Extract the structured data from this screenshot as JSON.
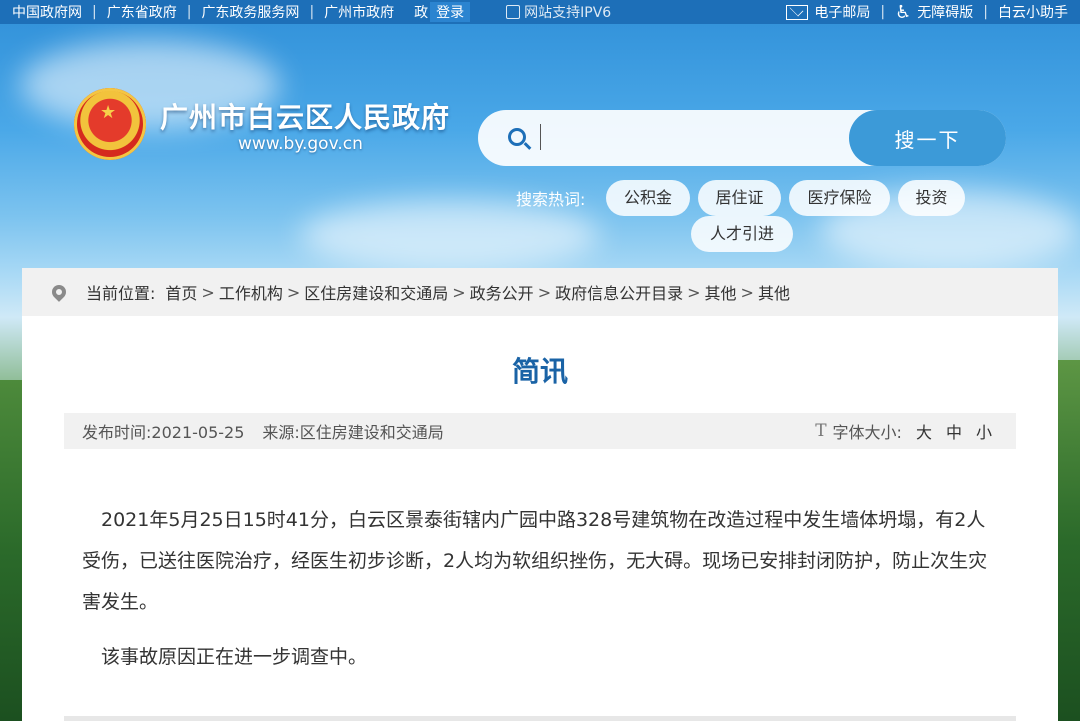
{
  "topbar": {
    "links": [
      "中国政府网",
      "广东省政府",
      "广东政务服务网",
      "广州市政府"
    ],
    "separator": "|",
    "zhengwu": "政",
    "login": "登录",
    "ipv6": "网站支持IPV6",
    "email": "电子邮局",
    "accessible": "无障碍版",
    "assistant": "白云小助手"
  },
  "header": {
    "site_title": "广州市白云区人民政府",
    "site_url": "www.by.gov.cn"
  },
  "search": {
    "placeholder": "",
    "button": "搜一下",
    "hot_label": "搜索热词:",
    "hot_tags": [
      "公积金",
      "居住证",
      "医疗保险",
      "投资",
      "人才引进"
    ]
  },
  "breadcrumb": {
    "label": "当前位置:",
    "items": [
      "首页",
      "工作机构",
      "区住房建设和交通局",
      "政务公开",
      "政府信息公开目录",
      "其他",
      "其他"
    ],
    "sep": ">"
  },
  "article": {
    "title": "简讯",
    "publish_label": "发布时间:",
    "publish_date": "2021-05-25",
    "source_label": "来源:",
    "source": "区住房建设和交通局",
    "fontsize_label": "字体大小:",
    "sizes": [
      "大",
      "中",
      "小"
    ],
    "paragraphs": [
      "2021年5月25日15时41分，白云区景泰街辖内广园中路328号建筑物在改造过程中发生墙体坍塌，有2人受伤，已送往医院治疗，经医生初步诊断，2人均为软组织挫伤，无大碍。现场已安排封闭防护，防止次生灾害发生。",
      "该事故原因正在进一步调查中。"
    ]
  },
  "colors": {
    "topbar": "#1d6fb8",
    "title": "#1a63a6",
    "search_button": "#3c9ad8"
  }
}
